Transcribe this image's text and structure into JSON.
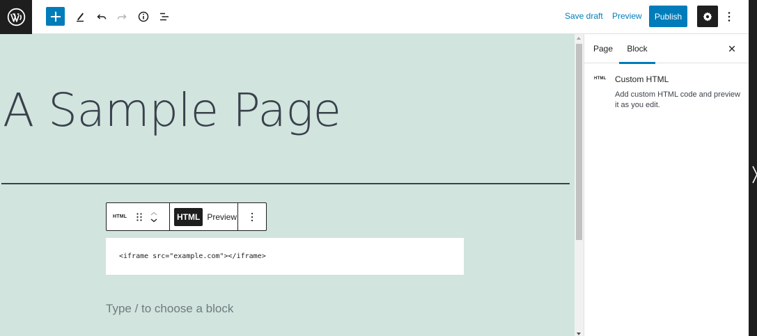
{
  "toolbar": {
    "save_draft": "Save draft",
    "preview": "Preview",
    "publish": "Publish",
    "icons": [
      "wordpress-logo-icon",
      "plus-icon",
      "pencil-icon",
      "undo-icon",
      "redo-icon",
      "info-icon",
      "list-view-icon",
      "gear-icon",
      "more-vertical-icon"
    ]
  },
  "canvas": {
    "title": "A Sample Page",
    "block_toolbar": {
      "block_type_icon": "HTML",
      "html_tab": "HTML",
      "preview_tab": "Preview"
    },
    "code": "<iframe src=\"example.com\"></iframe>",
    "appender_placeholder": "Type / to choose a block"
  },
  "sidebar": {
    "tabs": [
      {
        "label": "Page",
        "active": false
      },
      {
        "label": "Block",
        "active": true
      }
    ],
    "block_card": {
      "icon_text": "HTML",
      "title": "Custom HTML",
      "description": "Add custom HTML code and preview it as you edit."
    }
  },
  "colors": {
    "accent": "#007cba",
    "canvas_bg": "#d1e4dd",
    "title_color": "#39414d",
    "dark": "#1e1e1e"
  }
}
